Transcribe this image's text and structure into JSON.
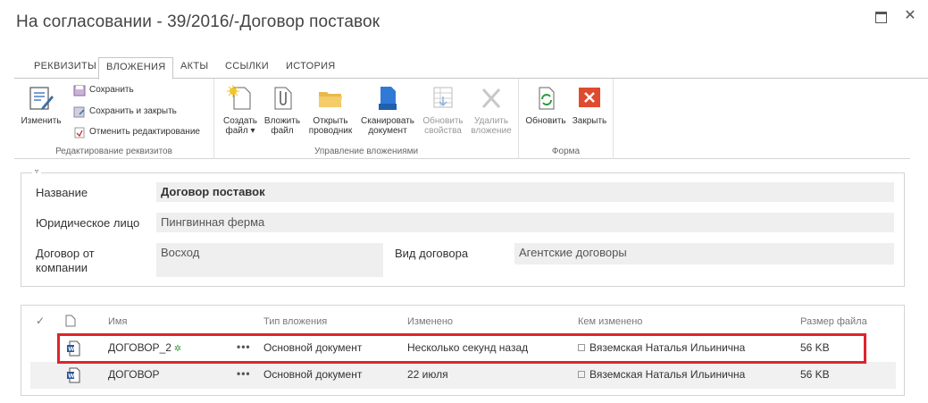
{
  "window": {
    "title": "На согласовании - 39/2016/-Договор поставок",
    "maximize_icon": "maximize-icon",
    "close_glyph": "✕"
  },
  "tabs": [
    {
      "label": "РЕКВИЗИТЫ"
    },
    {
      "label": "ВЛОЖЕНИЯ"
    },
    {
      "label": "АКТЫ"
    },
    {
      "label": "ССЫЛКИ"
    },
    {
      "label": "ИСТОРИЯ"
    }
  ],
  "ribbon": {
    "edit_group": {
      "label": "Редактирование реквизитов",
      "edit": "Изменить",
      "save": "Сохранить",
      "save_close": "Сохранить и закрыть",
      "cancel": "Отменить редактирование"
    },
    "attach_group": {
      "label": "Управление вложениями",
      "create_1": "Создать",
      "create_2": "файл ▾",
      "attach_1": "Вложить",
      "attach_2": "файл",
      "explorer_1": "Открыть",
      "explorer_2": "проводник",
      "scan_1": "Сканировать",
      "scan_2": "документ",
      "refresh_props_1": "Обновить",
      "refresh_props_2": "свойства",
      "delete_1": "Удалить",
      "delete_2": "вложение"
    },
    "form_group": {
      "label": "Форма",
      "refresh": "Обновить",
      "close": "Закрыть"
    }
  },
  "form": {
    "name_label": "Название",
    "name_value": "Договор поставок",
    "legal_label": "Юридическое лицо",
    "legal_value": "Пингвинная ферма",
    "company_label_1": "Договор от",
    "company_label_2": "компании",
    "company_value": "Восход",
    "type_label": "Вид договора",
    "type_value": "Агентские договоры"
  },
  "list": {
    "headers": {
      "check": "✓",
      "name": "Имя",
      "type": "Тип вложения",
      "modified": "Изменено",
      "modified_by": "Кем изменено",
      "size": "Размер файла"
    },
    "rows": [
      {
        "name": "ДОГОВОР_2",
        "new_marker": "✲",
        "menu": "•••",
        "type": "Основной документ",
        "modified": "Несколько секунд назад",
        "modified_by": "Вяземская Наталья Ильинична",
        "size": "56 KB"
      },
      {
        "name": "ДОГОВОР",
        "menu": "•••",
        "type": "Основной документ",
        "modified": "22 июля",
        "modified_by": "Вяземская Наталья Ильинична",
        "size": "56 KB"
      }
    ]
  },
  "colors": {
    "highlight": "#e0232e",
    "word_blue": "#2b579a",
    "close_red": "#e04a2f"
  }
}
